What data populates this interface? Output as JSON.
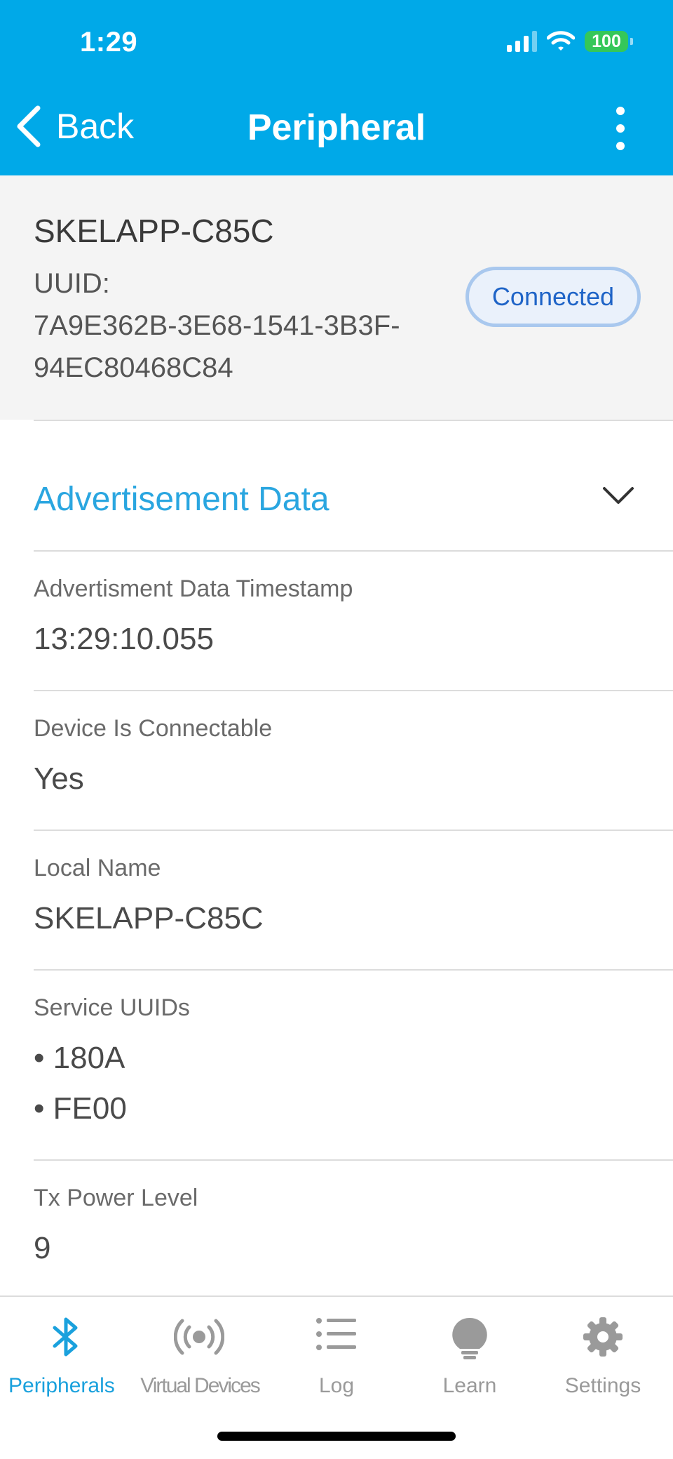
{
  "status_bar": {
    "time": "1:29",
    "battery": "100"
  },
  "nav": {
    "back_label": "Back",
    "title": "Peripheral"
  },
  "device": {
    "name": "SKELAPP-C85C",
    "uuid_label": "UUID:",
    "uuid_line1": "7A9E362B-3E68-1541-3B3F-",
    "uuid_line2": "94EC80468C84",
    "status": "Connected"
  },
  "advertisement": {
    "section_title": "Advertisement Data",
    "rows": [
      {
        "label": "Advertisment Data Timestamp",
        "value": "13:29:10.055"
      },
      {
        "label": "Device Is Connectable",
        "value": "Yes"
      },
      {
        "label": "Local Name",
        "value": "SKELAPP-C85C"
      },
      {
        "label": "Service UUIDs",
        "values": [
          "• 180A",
          "• FE00"
        ]
      },
      {
        "label": "Tx Power Level",
        "value": "9"
      }
    ]
  },
  "tabs": [
    {
      "label": "Peripherals",
      "icon": "bluetooth-icon",
      "active": true
    },
    {
      "label": "Virtual Devices",
      "icon": "broadcast-icon",
      "active": false
    },
    {
      "label": "Log",
      "icon": "list-icon",
      "active": false
    },
    {
      "label": "Learn",
      "icon": "lightbulb-icon",
      "active": false
    },
    {
      "label": "Settings",
      "icon": "gear-icon",
      "active": false
    }
  ],
  "colors": {
    "accent": "#00a9e8",
    "link": "#2aa6e0",
    "connected_text": "#1f64c7",
    "battery": "#35c759"
  }
}
